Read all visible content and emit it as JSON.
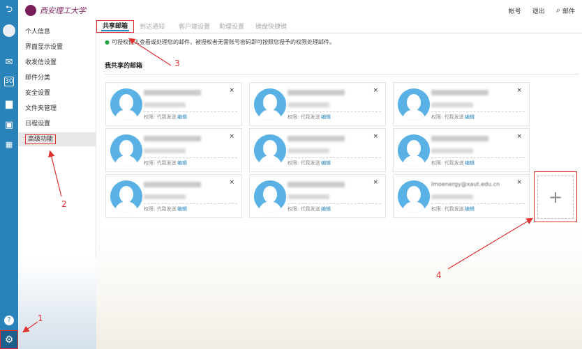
{
  "topbar": {
    "logo_text": "西安理工大学",
    "links": [
      "帐号",
      "退出"
    ],
    "search_placeholder": "邮件"
  },
  "sidebar": {
    "items": [
      {
        "label": "个人信息",
        "active": false
      },
      {
        "label": "界面显示设置",
        "active": false
      },
      {
        "label": "收发信设置",
        "active": false
      },
      {
        "label": "邮件分类",
        "active": false
      },
      {
        "label": "安全设置",
        "active": false
      },
      {
        "label": "文件夹管理",
        "active": false
      },
      {
        "label": "日程设置",
        "active": false
      },
      {
        "label": "高级功能",
        "active": true
      }
    ]
  },
  "tabs": [
    {
      "label": "共享邮箱",
      "active": true
    },
    {
      "label": "到达通知",
      "active": false
    },
    {
      "label": "客户端设置",
      "active": false
    },
    {
      "label": "助理设置",
      "active": false
    },
    {
      "label": "键盘快捷键",
      "active": false
    }
  ],
  "notice": "可授权他人查看或处理您的邮件，被授权者无需账号密码即可按照您授予的权限处理邮件。",
  "section_title": "我共享的邮箱",
  "cards": [
    {
      "permission": "权限: 代我发送",
      "edit": "编辑",
      "email_text": ""
    },
    {
      "permission": "权限: 代我发送",
      "edit": "编辑",
      "email_text": ""
    },
    {
      "permission": "权限: 代我发送",
      "edit": "编辑",
      "email_text": ""
    },
    {
      "permission": "权限: 代我发送",
      "edit": "编辑",
      "email_text": ""
    },
    {
      "permission": "权限: 代我发送",
      "edit": "编辑",
      "email_text": ""
    },
    {
      "permission": "权限: 代我发送",
      "edit": "编辑",
      "email_text": ""
    },
    {
      "permission": "权限: 代我发送",
      "edit": "编辑",
      "email_text": ""
    },
    {
      "permission": "权限: 代我发送",
      "edit": "编辑",
      "email_text": ""
    },
    {
      "permission": "权限: 代我发送",
      "edit": "编辑",
      "email_text": "lmoenergy@xaut.edu.cn"
    }
  ],
  "close_glyph": "×",
  "add_glyph": "+",
  "annotations": [
    "1",
    "2",
    "3",
    "4"
  ],
  "colors": {
    "accent": "#2a83b8",
    "annotation": "#e03030",
    "avatar": "#5ab1e6"
  }
}
